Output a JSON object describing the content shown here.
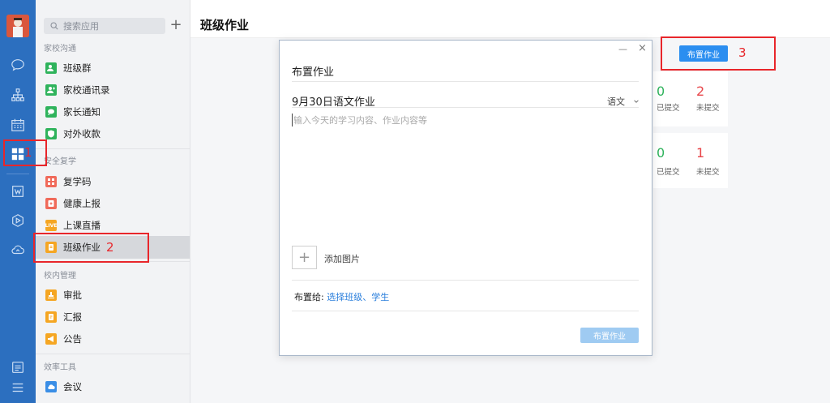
{
  "app": {
    "page_title": "班级作业",
    "accent_color": "#2b8ef0",
    "rail_color": "#2c6fbf"
  },
  "rail": {
    "icons": [
      "chat-icon",
      "org-icon",
      "calendar-icon",
      "apps-grid-icon",
      "doc-icon",
      "send-icon",
      "cloud-icon",
      "notes-icon",
      "menu-icon"
    ]
  },
  "nav": {
    "search_placeholder": "搜索应用",
    "sections": [
      {
        "title": "家校沟通",
        "items": [
          "班级群",
          "家校通讯录",
          "家长通知",
          "对外收款"
        ]
      },
      {
        "title": "安全复学",
        "items": [
          "复学码",
          "健康上报",
          "上课直播",
          "班级作业"
        ]
      },
      {
        "title": "校内管理",
        "items": [
          "审批",
          "汇报",
          "公告"
        ]
      },
      {
        "title": "效率工具",
        "items": [
          "会议"
        ]
      }
    ],
    "live_badge": "LIVE"
  },
  "main": {
    "assign_button": "布置作业",
    "cards": [
      {
        "submitted": "0",
        "submitted_label": "已提交",
        "unsubmitted": "2",
        "unsubmitted_label": "未提交"
      },
      {
        "submitted": "0",
        "submitted_label": "已提交",
        "unsubmitted": "1",
        "unsubmitted_label": "未提交"
      }
    ]
  },
  "dialog": {
    "minimize": "—",
    "close": "×",
    "title": "布置作业",
    "homework_title": "9月30日语文作业",
    "subject": "语文",
    "content_placeholder": "输入今天的学习内容、作业内容等",
    "add_image_label": "添加图片",
    "assign_to_label": "布置给:",
    "assign_to_link": "选择班级、学生",
    "submit_button": "布置作业"
  },
  "annotations": {
    "one": "1",
    "two": "2",
    "three": "3"
  }
}
